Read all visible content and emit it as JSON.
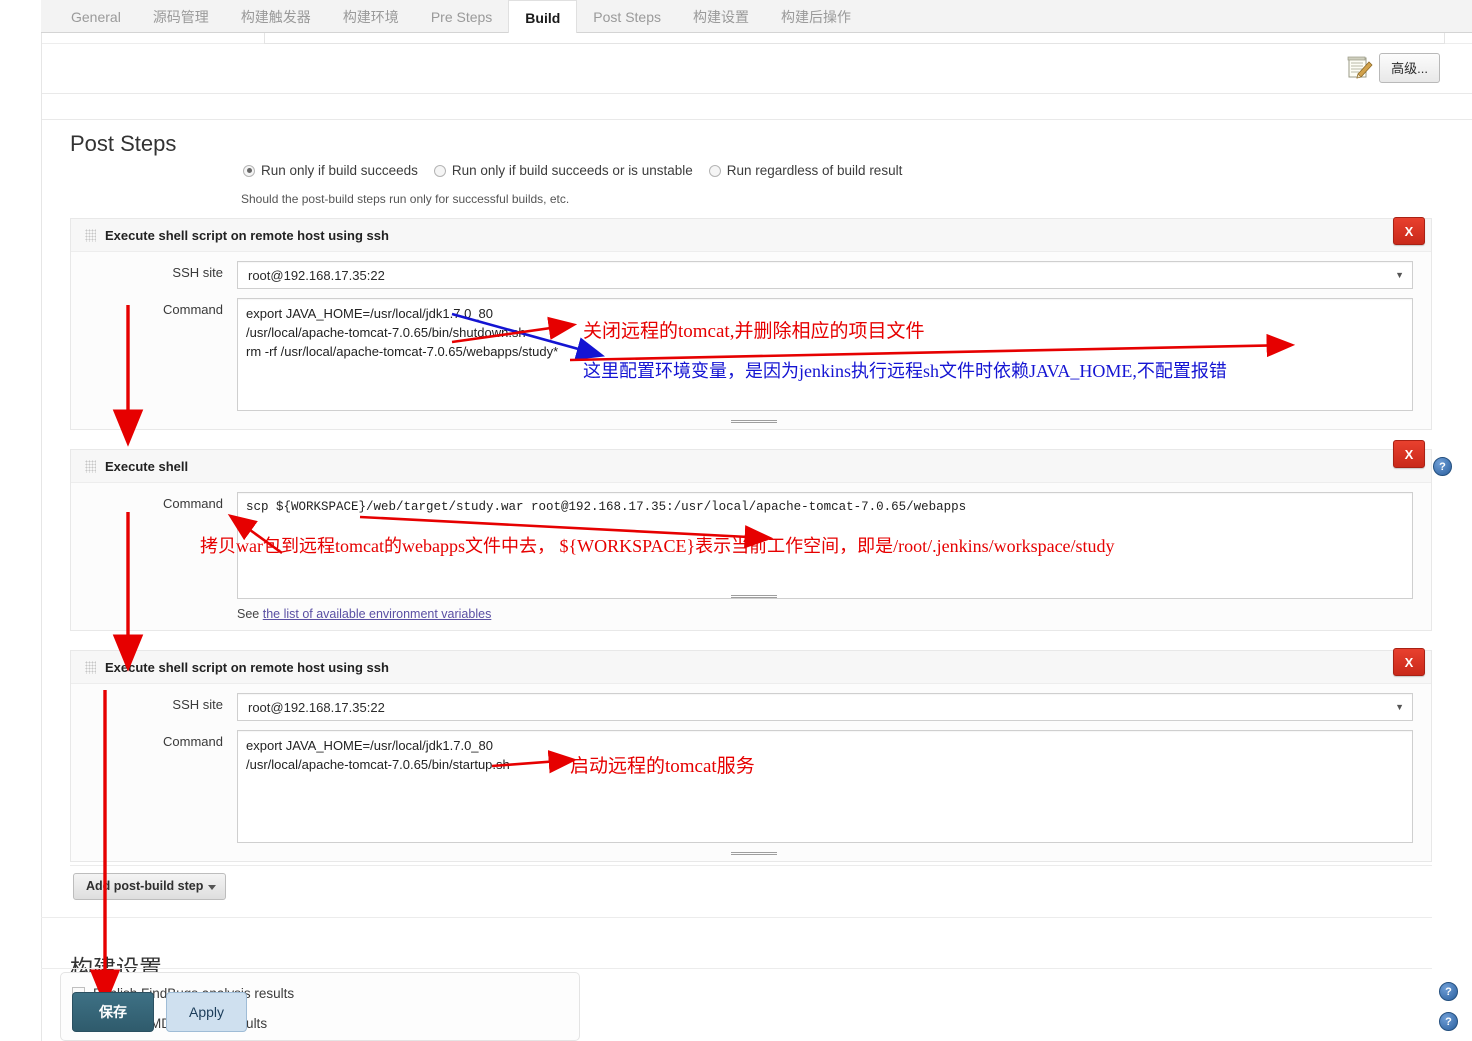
{
  "tabs": [
    {
      "label": "General",
      "active": false
    },
    {
      "label": "源码管理",
      "active": false
    },
    {
      "label": "构建触发器",
      "active": false
    },
    {
      "label": "构建环境",
      "active": false
    },
    {
      "label": "Pre Steps",
      "active": false
    },
    {
      "label": "Build",
      "active": true
    },
    {
      "label": "Post Steps",
      "active": false
    },
    {
      "label": "构建设置",
      "active": false
    },
    {
      "label": "构建后操作",
      "active": false
    }
  ],
  "toolbar": {
    "advanced_label": "高级...",
    "advanced_icon": "notepad-pencil-icon"
  },
  "post_steps": {
    "title": "Post Steps",
    "radios": [
      {
        "label": "Run only if build succeeds",
        "checked": true
      },
      {
        "label": "Run only if build succeeds or is unstable",
        "checked": false
      },
      {
        "label": "Run regardless of build result",
        "checked": false
      }
    ],
    "hint": "Should the post-build steps run only for successful builds, etc."
  },
  "steps": [
    {
      "title": "Execute shell script on remote host using ssh",
      "delete_label": "X",
      "ssh_site_label": "SSH site",
      "ssh_site_value": "root@192.168.17.35:22",
      "command_label": "Command",
      "command_value": "export JAVA_HOME=/usr/local/jdk1.7.0_80\n/usr/local/apache-tomcat-7.0.65/bin/shutdown.sh\nrm -rf /usr/local/apache-tomcat-7.0.65/webapps/study*"
    },
    {
      "title": "Execute shell",
      "delete_label": "X",
      "command_label": "Command",
      "command_value": "scp ${WORKSPACE}/web/target/study.war root@192.168.17.35:/usr/local/apache-tomcat-7.0.65/webapps",
      "env_prefix": "See ",
      "env_link": "the list of available environment variables",
      "help_label": "?"
    },
    {
      "title": "Execute shell script on remote host using ssh",
      "delete_label": "X",
      "ssh_site_label": "SSH site",
      "ssh_site_value": "root@192.168.17.35:22",
      "command_label": "Command",
      "command_value": "export JAVA_HOME=/usr/local/jdk1.7.0_80\n/usr/local/apache-tomcat-7.0.65/bin/startup.sh"
    }
  ],
  "add_step": {
    "label": "Add post-build step"
  },
  "build_settings": {
    "title": "构建设置",
    "checkboxes": [
      {
        "label": "Publish FindBugs analysis results",
        "checked": false
      },
      {
        "label": "Publish PMD analysis results",
        "checked": false
      }
    ],
    "help_label": "?"
  },
  "footer": {
    "save_label": "保存",
    "apply_label": "Apply"
  },
  "annotations": [
    {
      "id": "a1",
      "text": "关闭远程的tomcat,并删除相应的项目文件",
      "color": "#e60000"
    },
    {
      "id": "a2",
      "text": "这里配置环境变量，是因为jenkins执行远程sh文件时依赖JAVA_HOME,不配置报错",
      "color": "#1414d2"
    },
    {
      "id": "a3",
      "text": "拷贝war包到远程tomcat的webapps文件中去， ${WORKSPACE}表示当前工作空间，即是/root/.jenkins/workspace/study",
      "color": "#e60000"
    },
    {
      "id": "a4",
      "text": "启动远程的tomcat服务",
      "color": "#e60000"
    }
  ],
  "colors": {
    "accent_red": "#e60000",
    "accent_blue": "#1414d2",
    "delete_red": "#c9291a",
    "save_teal": "#2f5b6c",
    "apply_blue": "#cfe0ef",
    "help_blue": "#2a5f9e"
  }
}
